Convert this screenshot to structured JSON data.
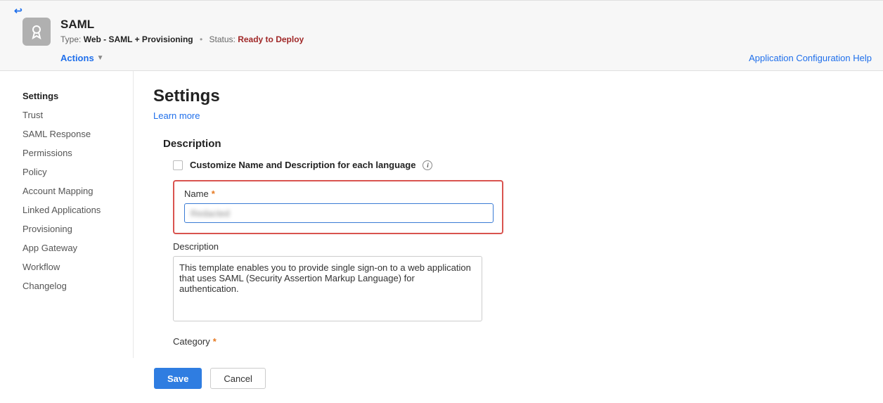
{
  "header": {
    "title": "SAML",
    "type_label": "Type:",
    "type_value": "Web - SAML + Provisioning",
    "status_label": "Status:",
    "status_value": "Ready to Deploy",
    "actions_label": "Actions",
    "help_link": "Application Configuration Help"
  },
  "sidebar": {
    "items": [
      {
        "label": "Settings",
        "active": true
      },
      {
        "label": "Trust",
        "active": false
      },
      {
        "label": "SAML Response",
        "active": false
      },
      {
        "label": "Permissions",
        "active": false
      },
      {
        "label": "Policy",
        "active": false
      },
      {
        "label": "Account Mapping",
        "active": false
      },
      {
        "label": "Linked Applications",
        "active": false
      },
      {
        "label": "Provisioning",
        "active": false
      },
      {
        "label": "App Gateway",
        "active": false
      },
      {
        "label": "Workflow",
        "active": false
      },
      {
        "label": "Changelog",
        "active": false
      }
    ]
  },
  "main": {
    "title": "Settings",
    "learn_more": "Learn more",
    "description_heading": "Description",
    "customize_label": "Customize Name and Description for each language",
    "name_label": "Name",
    "name_value": "Redacted",
    "description_label": "Description",
    "description_value": "This template enables you to provide single sign-on to a web application that uses SAML (Security Assertion Markup Language) for authentication.",
    "category_label": "Category"
  },
  "footer": {
    "save": "Save",
    "cancel": "Cancel"
  }
}
